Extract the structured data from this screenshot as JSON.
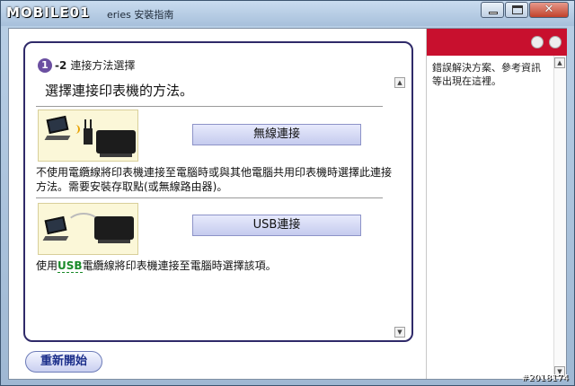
{
  "window": {
    "logo": "MOBILE01",
    "title": "eries 安裝指南",
    "min_icon": "minimize-icon",
    "max_icon": "maximize-icon",
    "close_icon": "close-icon"
  },
  "step": {
    "number": "1",
    "sub": "-2",
    "label": "連接方法選擇"
  },
  "heading": "選擇連接印表機的方法。",
  "options": [
    {
      "button_label": "無線連接",
      "illustration_icon": "wireless-connection-icon",
      "description": "不使用電纜線將印表機連接至電腦時或與其他電腦共用印表機時選擇此連接方法。需要安裝存取點(或無線路由器)。"
    },
    {
      "button_label": "USB連接",
      "illustration_icon": "usb-connection-icon",
      "description_prefix": "使用",
      "description_em": "USB",
      "description_suffix": "電纜線將印表機連接至電腦時選擇該項。"
    }
  ],
  "restart_label": "重新開始",
  "side": {
    "help_text": "錯誤解決方案、參考資訊等出現在這裡。"
  },
  "watermark": "#2018174",
  "colors": {
    "panel_border": "#2f2a69",
    "side_header": "#c8102e",
    "option_button": "#c5cbee"
  }
}
